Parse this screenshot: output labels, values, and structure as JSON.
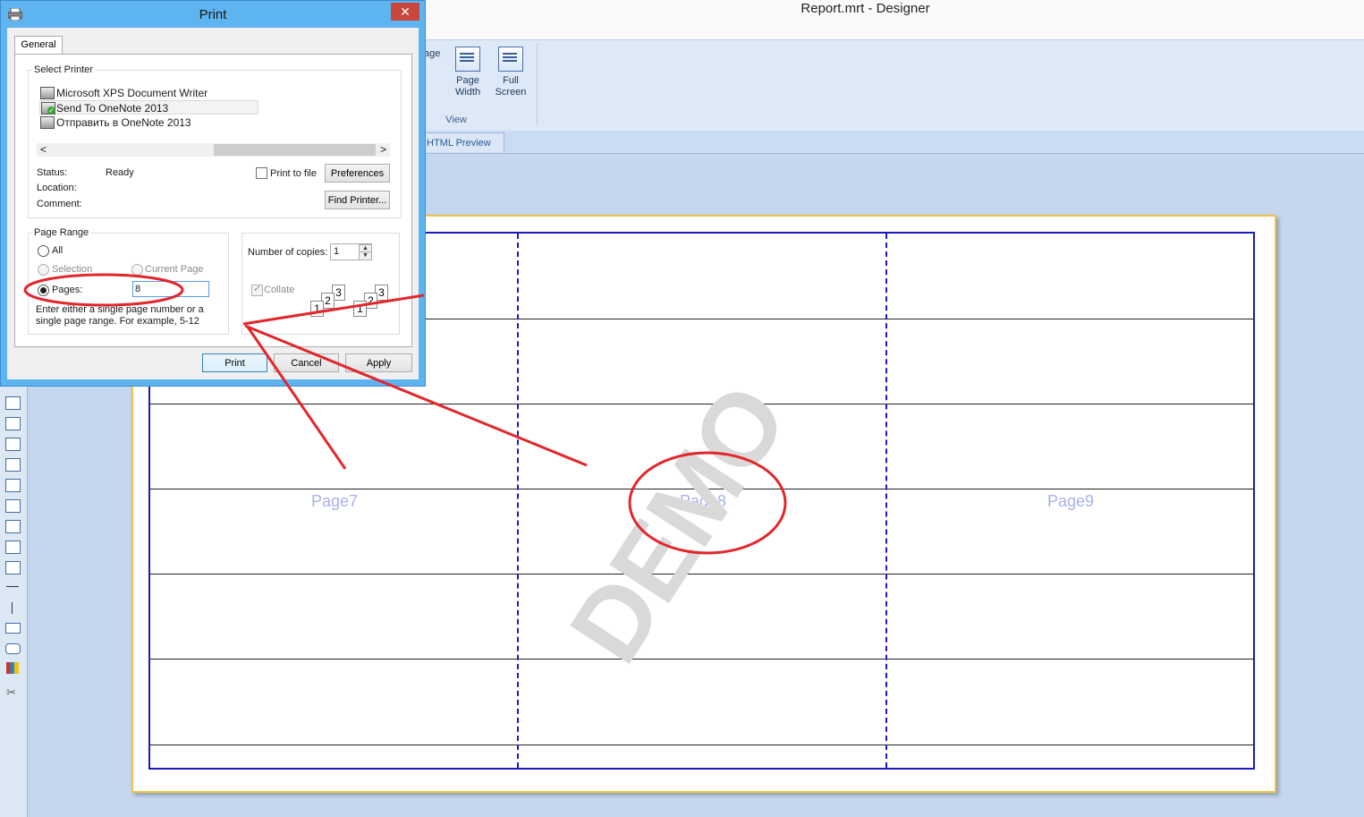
{
  "window": {
    "title": "Report.mrt  - Designer"
  },
  "ribbon": {
    "partial_label": "age",
    "buttons": [
      {
        "line1": "Page",
        "line2": "Width",
        "icon": "page-width-icon"
      },
      {
        "line1": "Full",
        "line2": "Screen",
        "icon": "full-screen-icon"
      }
    ],
    "group_label": "View"
  },
  "tabs": {
    "html_preview": "HTML Preview"
  },
  "report": {
    "page_labels": [
      "Page7",
      "Page8",
      "Page9"
    ],
    "watermark": "DEMO"
  },
  "dialog": {
    "title": "Print",
    "close_glyph": "✕",
    "tab": "General",
    "select_printer": {
      "legend": "Select Printer",
      "printers": [
        "Microsoft XPS Document Writer",
        "Send To OneNote 2013",
        "Отправить в OneNote 2013"
      ],
      "selected_index": 1,
      "scroll_left": "<",
      "scroll_right": ">"
    },
    "status_label": "Status:",
    "status_value": "Ready",
    "location_label": "Location:",
    "comment_label": "Comment:",
    "print_to_file": "Print to file",
    "preferences": "Preferences",
    "find_printer": "Find Printer...",
    "page_range": {
      "legend": "Page Range",
      "all": "All",
      "selection": "Selection",
      "current_page": "Current Page",
      "pages": "Pages:",
      "pages_value": "8",
      "hint": "Enter either a single page number or a single page range.  For example, 5-12"
    },
    "copies": {
      "label": "Number of copies:",
      "value": "1",
      "collate": "Collate",
      "collate_checked": true
    },
    "buttons": {
      "print": "Print",
      "cancel": "Cancel",
      "apply": "Apply"
    }
  },
  "colors": {
    "annotation": "#e2262b",
    "page_border": "#1b1bbd",
    "dialog_frame": "#5eb4ef"
  }
}
